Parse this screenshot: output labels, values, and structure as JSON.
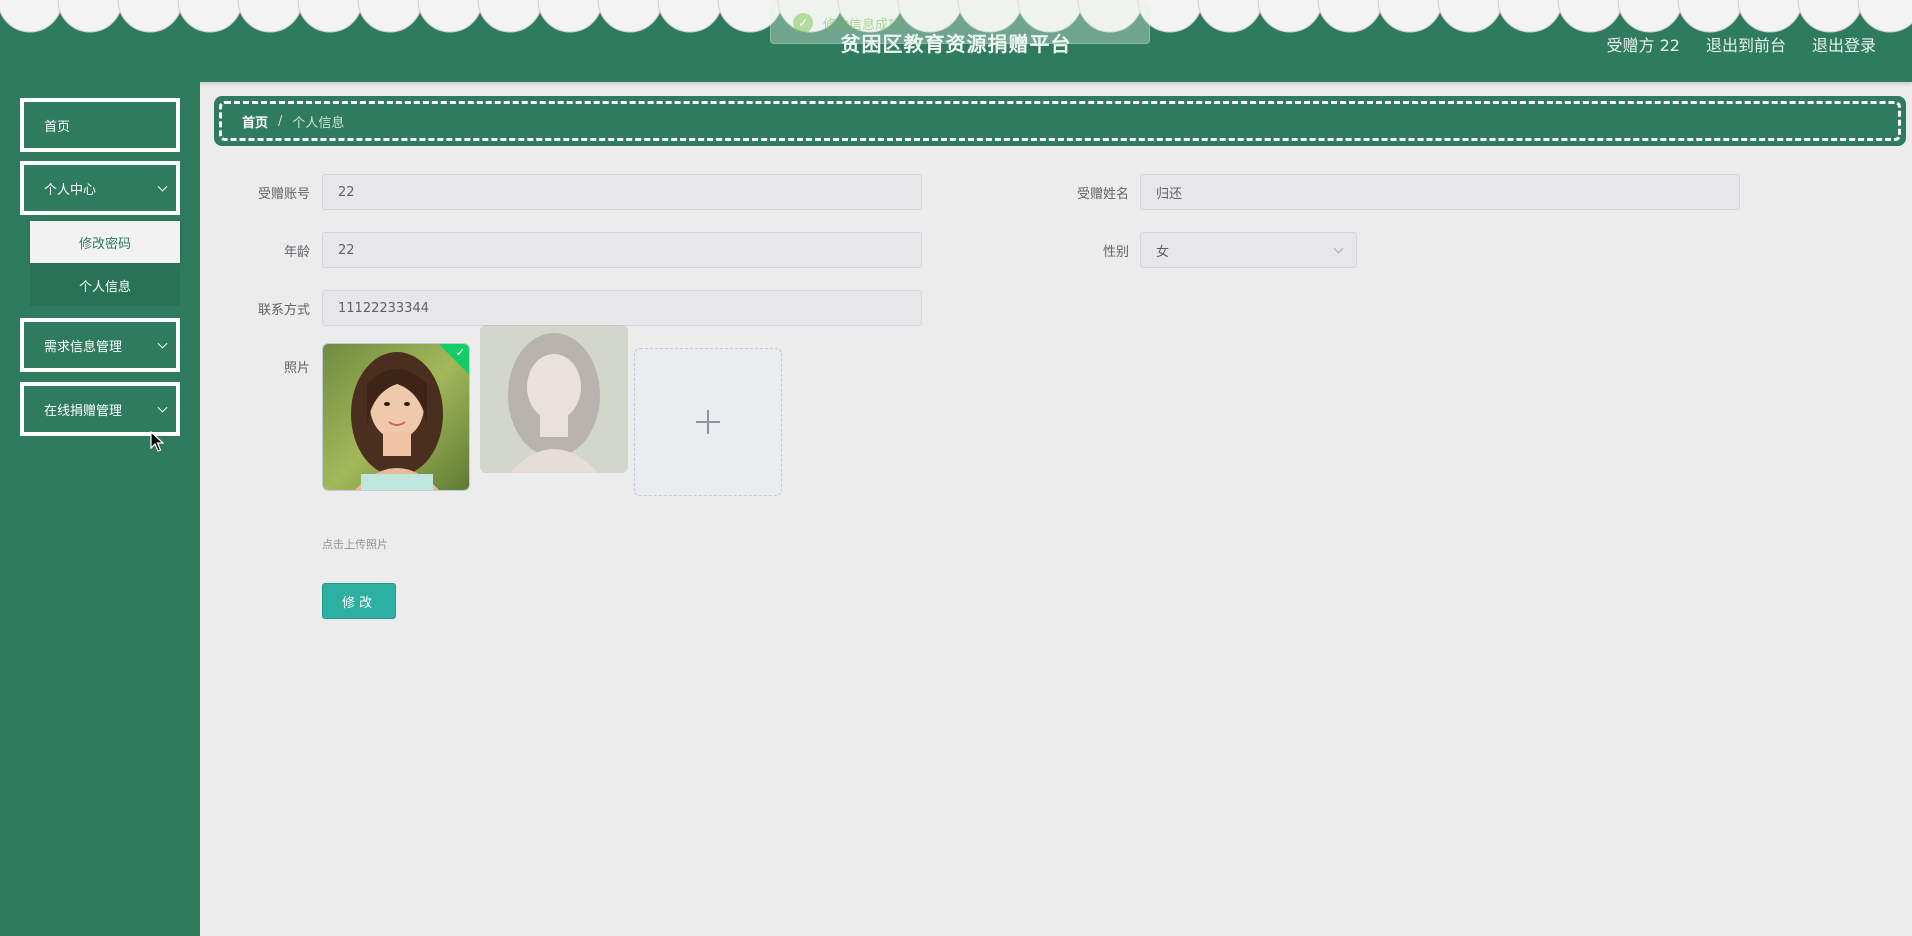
{
  "app": {
    "title": "贫困区教育资源捐赠平台",
    "user_label": "受赠方 22",
    "front_link": "退出到前台",
    "logout_link": "退出登录"
  },
  "toast": {
    "message": "修改信息成功",
    "icon": "check-circle-icon"
  },
  "sidebar": {
    "items": [
      {
        "label": "首页"
      },
      {
        "label": "个人中心",
        "expanded": true,
        "children": [
          {
            "label": "修改密码"
          },
          {
            "label": "个人信息"
          }
        ]
      },
      {
        "label": "需求信息管理"
      },
      {
        "label": "在线捐赠管理"
      }
    ]
  },
  "breadcrumb": {
    "home": "首页",
    "separator": "/",
    "current": "个人信息"
  },
  "form": {
    "account": {
      "label": "受赠账号",
      "value": "22"
    },
    "name": {
      "label": "受赠姓名",
      "value": "归还"
    },
    "age": {
      "label": "年龄",
      "value": "22"
    },
    "gender": {
      "label": "性别",
      "value": "女"
    },
    "phone": {
      "label": "联系方式",
      "value": "11122233344"
    },
    "photo": {
      "label": "照片",
      "hint": "点击上传照片"
    },
    "submit_label": "修改"
  },
  "colors": {
    "primary": "#2f7b5e",
    "button": "#2bb0a1",
    "background": "#ececec"
  }
}
